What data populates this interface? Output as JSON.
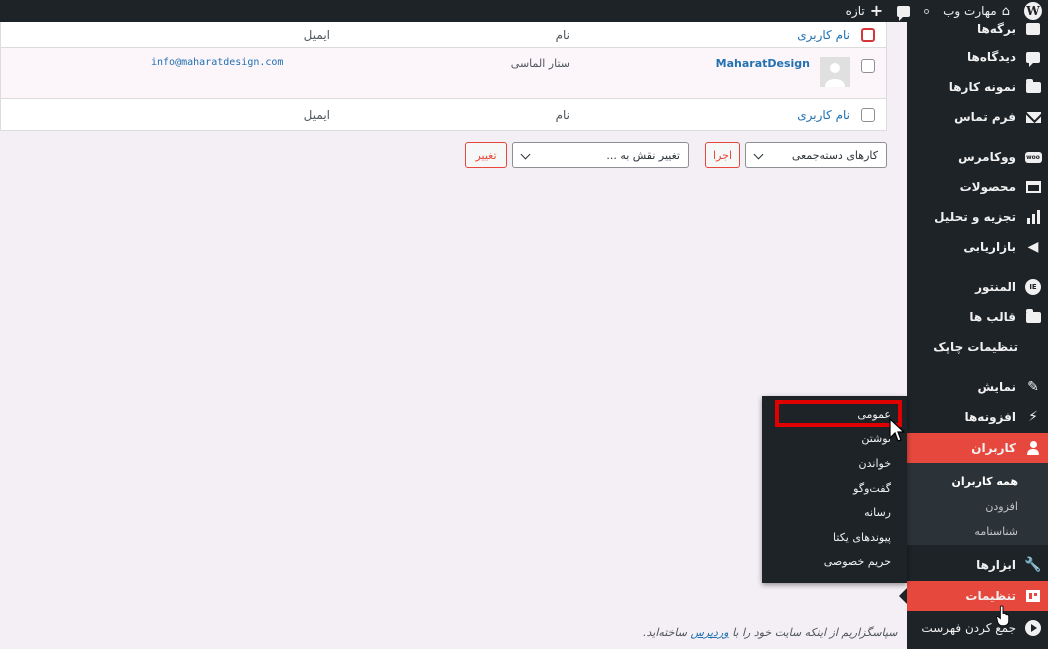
{
  "adminbar": {
    "site_name": "مهارت وب",
    "new_label": "تازه"
  },
  "sidebar": {
    "items": [
      {
        "label": "برگه‌ها"
      },
      {
        "label": "دیدگاه‌ها"
      },
      {
        "label": "نمونه کارها"
      },
      {
        "label": "فرم تماس"
      },
      {
        "label": "ووکامرس"
      },
      {
        "label": "محصولات"
      },
      {
        "label": "تجزیه و تحلیل"
      },
      {
        "label": "بازاریابی"
      },
      {
        "label": "المنتور"
      },
      {
        "label": "قالب ها"
      },
      {
        "label": "تنظیمات چاپک"
      },
      {
        "label": "نمایش"
      },
      {
        "label": "افزونه‌ها"
      },
      {
        "label": "کاربران"
      },
      {
        "label": "ابزارها"
      },
      {
        "label": "تنظیمات"
      },
      {
        "label": "جمع کردن فهرست"
      }
    ],
    "users_submenu": [
      "همه کاربران",
      "افزودن",
      "شناسنامه"
    ]
  },
  "settings_flyout": [
    "عمومی",
    "نوشتن",
    "خواندن",
    "گفت‌وگو",
    "رسانه",
    "پیوندهای یکتا",
    "حریم خصوصی"
  ],
  "table": {
    "col_username": "نام کاربری",
    "col_name": "نام",
    "col_email": "ایمیل",
    "rows": [
      {
        "username": "MaharatDesign",
        "name": "ستار الماسی",
        "email": "info@maharatdesign.com"
      }
    ]
  },
  "bulk": {
    "actions_placeholder": "کارهای دسته‌جمعی",
    "apply_label": "اجرا",
    "role_placeholder": "تغییر نقش به ...",
    "change_label": "تغییر"
  },
  "footer": {
    "prefix": "سپاسگزاریم از اینکه سایت خود را با",
    "link": "وردپرس",
    "suffix": "ساخته‌اید."
  },
  "colors": {
    "accent": "#e6483d",
    "sidebar_bg": "#1d2327",
    "link": "#2271b1",
    "highlight": "#e00000"
  }
}
